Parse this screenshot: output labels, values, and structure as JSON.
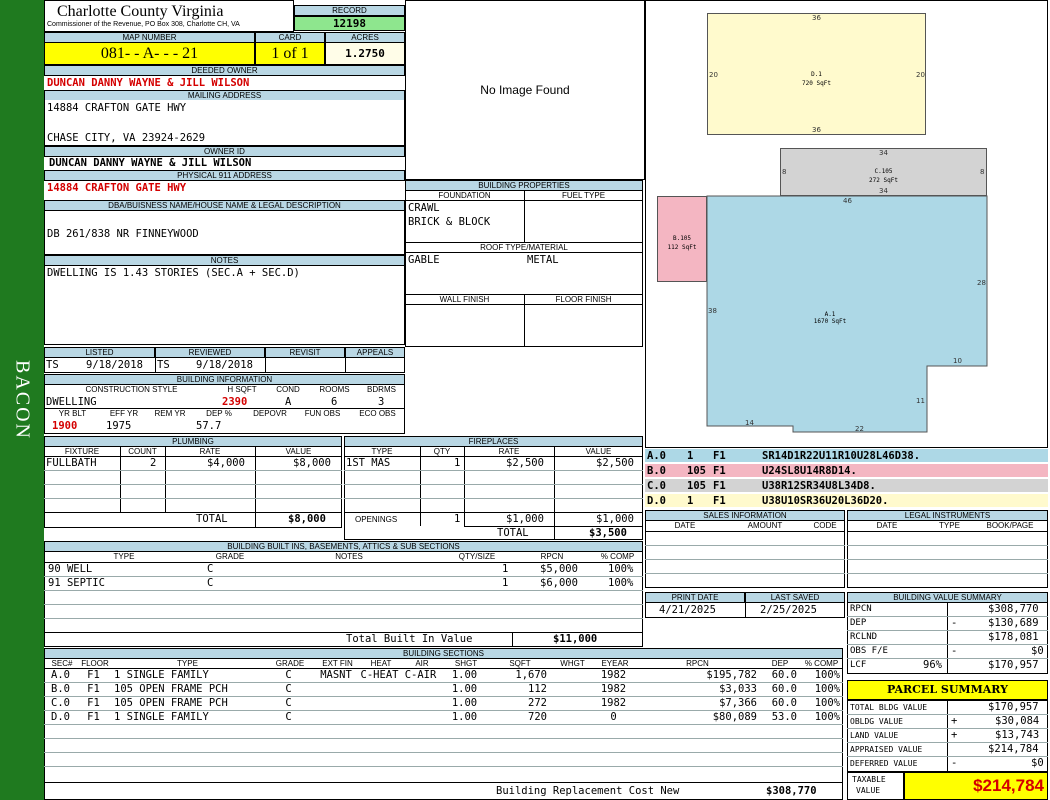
{
  "sidebar": {
    "name": "BACON"
  },
  "header": {
    "county": "Charlotte County Virginia",
    "office": "Commissioner of the Revenue, PO Box 308, Charlotte CH, VA",
    "record_label": "RECORD",
    "record": "12198"
  },
  "parcel": {
    "map_label": "MAP NUMBER",
    "map": "081- - A- - - 21",
    "card_label": "CARD",
    "card": "1 of 1",
    "acres_label": "ACRES",
    "acres": "1.2750"
  },
  "owner": {
    "deeded_label": "DEEDED OWNER",
    "deeded": "DUNCAN DANNY WAYNE & JILL WILSON",
    "mailing_label": "MAILING ADDRESS",
    "mail1": "14884 CRAFTON GATE HWY",
    "mail2": "CHASE CITY, VA 23924-2629",
    "ownerid_label": "OWNER ID",
    "ownerid": "DUNCAN DANNY WAYNE & JILL WILSON",
    "phys_label": "PHYSICAL 911 ADDRESS",
    "phys": "14884 CRAFTON GATE HWY",
    "dba_label": "DBA/BUISNESS NAME/HOUSE NAME & LEGAL DESCRIPTION",
    "dba": "DB 261/838 NR FINNEYWOOD",
    "notes_label": "NOTES",
    "notes": "DWELLING IS 1.43 STORIES (SEC.A + SEC.D)"
  },
  "image": {
    "text": "No Image Found"
  },
  "building_props": {
    "title": "BUILDING PROPERTIES",
    "foundation_label": "FOUNDATION",
    "fuel_label": "FUEL TYPE",
    "foundation1": "CRAWL",
    "foundation2": "BRICK & BLOCK",
    "roof_label": "ROOF TYPE/MATERIAL",
    "roof_type": "GABLE",
    "roof_mat": "METAL",
    "wall_label": "WALL FINISH",
    "floor_label": "FLOOR FINISH"
  },
  "review": {
    "listed_label": "LISTED",
    "listed_by": "TS",
    "listed_date": "9/18/2018",
    "reviewed_label": "REVIEWED",
    "reviewed_by": "TS",
    "reviewed_date": "9/18/2018",
    "revisit_label": "REVISIT",
    "appeals_label": "APPEALS"
  },
  "building_info": {
    "title": "BUILDING INFORMATION",
    "style_label": "CONSTRUCTION STYLE",
    "hsqft_label": "H SQFT",
    "cond_label": "COND",
    "rooms_label": "ROOMS",
    "bdrms_label": "BDRMS",
    "style": "DWELLING",
    "hsqft": "2390",
    "cond": "A",
    "rooms": "6",
    "bdrms": "3",
    "yrblt_label": "YR BLT",
    "effyr_label": "EFF YR",
    "remyr_label": "REM YR",
    "dep_label": "DEP %",
    "depovr_label": "DEPOVR",
    "funobs_label": "FUN OBS",
    "ecoobs_label": "ECO OBS",
    "yrblt": "1900",
    "effyr": "1975",
    "dep": "57.7"
  },
  "plumbing": {
    "title": "PLUMBING",
    "h_fixture": "FIXTURE",
    "h_count": "COUNT",
    "h_rate": "RATE",
    "h_value": "VALUE",
    "fixture": "FULLBATH",
    "count": "2",
    "rate": "$4,000",
    "value": "$8,000",
    "total_label": "TOTAL",
    "total": "$8,000"
  },
  "fireplaces": {
    "title": "FIREPLACES",
    "h_type": "TYPE",
    "h_qty": "QTY",
    "h_rate": "RATE",
    "h_value": "VALUE",
    "type": "1ST MAS",
    "qty": "1",
    "rate": "$2,500",
    "value": "$2,500",
    "openings_label": "OPENINGS",
    "op_qty": "1",
    "op_rate": "$1,000",
    "op_value": "$1,000",
    "total_label": "TOTAL",
    "total": "$3,500"
  },
  "builtins": {
    "title": "BUILDING BUILT INS, BASEMENTS, ATTICS & SUB SECTIONS",
    "h_type": "TYPE",
    "h_grade": "GRADE",
    "h_notes": "NOTES",
    "h_qty": "QTY/SIZE",
    "h_rpcn": "RPCN",
    "h_comp": "% COMP",
    "rows": [
      {
        "type": "90 WELL",
        "grade": "C",
        "qty": "1",
        "rpcn": "$5,000",
        "comp": "100%"
      },
      {
        "type": "91 SEPTIC",
        "grade": "C",
        "qty": "1",
        "rpcn": "$6,000",
        "comp": "100%"
      }
    ],
    "total_label": "Total Built In Value",
    "total": "$11,000"
  },
  "sections": {
    "title": "BUILDING SECTIONS",
    "h": {
      "sec": "SEC#",
      "floor": "FLOOR",
      "type": "TYPE",
      "grade": "GRADE",
      "extfin": "EXT FIN",
      "heat": "HEAT",
      "air": "AIR",
      "shgt": "SHGT",
      "sqft": "SQFT",
      "whgt": "WHGT",
      "eyear": "EYEAR",
      "rpcn": "RPCN",
      "dep": "DEP",
      "comp": "% COMP"
    },
    "rows": [
      {
        "sec": "A.0",
        "floor": "F1",
        "type": "1 SINGLE FAMILY",
        "grade": "C",
        "extfin": "MASNT",
        "heat": "C-HEAT",
        "air": "C-AIR",
        "shgt": "1.00",
        "sqft": "1,670",
        "whgt": "",
        "eyear": "1982",
        "rpcn": "$195,782",
        "dep": "60.0",
        "comp": "100%"
      },
      {
        "sec": "B.0",
        "floor": "F1",
        "type": "105 OPEN FRAME PCH",
        "grade": "C",
        "extfin": "",
        "heat": "",
        "air": "",
        "shgt": "1.00",
        "sqft": "112",
        "whgt": "",
        "eyear": "1982",
        "rpcn": "$3,033",
        "dep": "60.0",
        "comp": "100%"
      },
      {
        "sec": "C.0",
        "floor": "F1",
        "type": "105 OPEN FRAME PCH",
        "grade": "C",
        "extfin": "",
        "heat": "",
        "air": "",
        "shgt": "1.00",
        "sqft": "272",
        "whgt": "",
        "eyear": "1982",
        "rpcn": "$7,366",
        "dep": "60.0",
        "comp": "100%"
      },
      {
        "sec": "D.0",
        "floor": "F1",
        "type": "1 SINGLE FAMILY",
        "grade": "C",
        "extfin": "",
        "heat": "",
        "air": "",
        "shgt": "1.00",
        "sqft": "720",
        "whgt": "",
        "eyear": "0",
        "rpcn": "$80,089",
        "dep": "53.0",
        "comp": "100%"
      }
    ],
    "replacement_label": "Building Replacement Cost New",
    "replacement": "$308,770"
  },
  "sketch": {
    "d_label": "D.1",
    "d_area": "720 SqFt",
    "c_label": "C.105",
    "c_area": "272 SqFt",
    "b_label": "B.105",
    "b_area": "112 SqFt",
    "a_label": "A.1",
    "a_area": "1670 SqFt",
    "dims": {
      "d_top": "36",
      "d_bottom": "36",
      "d_left": "20",
      "d_right": "20",
      "c_top": "34",
      "c_bottom": "34",
      "c_left": "8",
      "c_right": "8",
      "a_46": "46",
      "a_28": "28",
      "a_38": "38",
      "a_10": "10",
      "a_11": "11",
      "a_14": "14",
      "a_22": "22"
    },
    "colors": {
      "a": "#add8e6",
      "b": "#f4b6c2",
      "c": "#d3d3d3",
      "d": "#fffacd"
    }
  },
  "legend": [
    {
      "sec": "A.0",
      "n": "1",
      "f": "F1",
      "path": "SR14D1R22U11R10U28L46D38."
    },
    {
      "sec": "B.0",
      "n": "105",
      "f": "F1",
      "path": "U24SL8U14R8D14."
    },
    {
      "sec": "C.0",
      "n": "105",
      "f": "F1",
      "path": "U38R12SR34U8L34D8."
    },
    {
      "sec": "D.0",
      "n": "1",
      "f": "F1",
      "path": "U38U10SR36U20L36D20."
    }
  ],
  "sales": {
    "title": "SALES INFORMATION",
    "h_date": "DATE",
    "h_amount": "AMOUNT",
    "h_code": "CODE"
  },
  "legal": {
    "title": "LEGAL INSTRUMENTS",
    "h_date": "DATE",
    "h_type": "TYPE",
    "h_book": "BOOK/PAGE"
  },
  "dates": {
    "print_label": "PRINT DATE",
    "print": "4/21/2025",
    "saved_label": "LAST SAVED",
    "saved": "2/25/2025"
  },
  "value_summary": {
    "title": "BUILDING VALUE SUMMARY",
    "rpcn_label": "RPCN",
    "rpcn": "$308,770",
    "dep_label": "DEP",
    "dep_sign": "-",
    "dep": "$130,689",
    "rclnd_label": "RCLND",
    "rclnd": "$178,081",
    "obs_label": "OBS F/E",
    "obs_sign": "-",
    "obs": "$0",
    "lcf_label": "LCF",
    "lcf_pct": "96%",
    "lcf": "$170,957"
  },
  "parcel_summary": {
    "title": "PARCEL SUMMARY",
    "bldg_label": "TOTAL BLDG VALUE",
    "bldg": "$170,957",
    "obldg_label": "OBLDG VALUE",
    "obldg_sign": "+",
    "obldg": "$30,084",
    "land_label": "LAND VALUE",
    "land_sign": "+",
    "land": "$13,743",
    "appraised_label": "APPRAISED VALUE",
    "appraised": "$214,784",
    "deferred_label": "DEFERRED VALUE",
    "deferred_sign": "-",
    "deferred": "$0",
    "taxable_label1": "TAXABLE",
    "taxable_label2": "VALUE",
    "taxable": "$214,784"
  }
}
